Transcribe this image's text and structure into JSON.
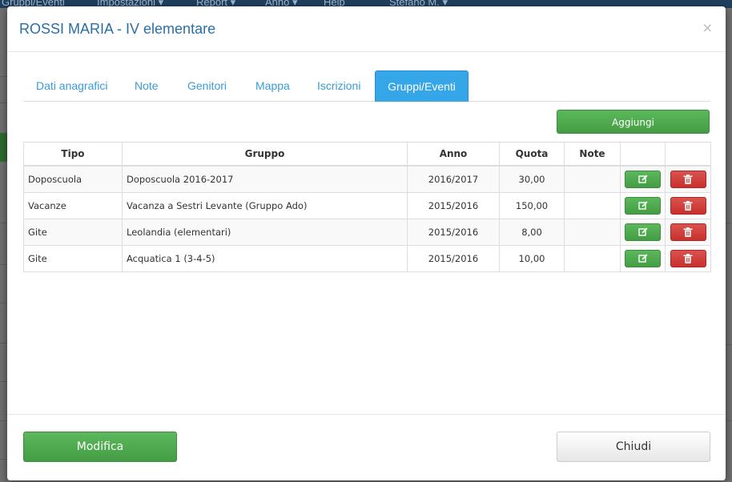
{
  "background_nav": {
    "items": [
      "Gruppi/Eventi",
      "Impostazioni ▾",
      "Report ▾",
      "Anno ▾",
      "Help",
      "Stefano M. ▾"
    ]
  },
  "modal": {
    "title": "ROSSI MARIA - IV elementare",
    "close_icon": "×",
    "tabs": [
      {
        "label": "Dati anagrafici",
        "active": false
      },
      {
        "label": "Note",
        "active": false
      },
      {
        "label": "Genitori",
        "active": false
      },
      {
        "label": "Mappa",
        "active": false
      },
      {
        "label": "Iscrizioni",
        "active": false
      },
      {
        "label": "Gruppi/Eventi",
        "active": true
      }
    ],
    "add_button": "Aggiungi",
    "table": {
      "headers": [
        "Tipo",
        "Gruppo",
        "Anno",
        "Quota",
        "Note",
        "",
        ""
      ],
      "rows": [
        {
          "tipo": "Doposcuola",
          "gruppo": "Doposcuola 2016-2017",
          "anno": "2016/2017",
          "quota": "30,00",
          "note": ""
        },
        {
          "tipo": "Vacanze",
          "gruppo": "Vacanza a Sestri Levante (Gruppo Ado)",
          "anno": "2015/2016",
          "quota": "150,00",
          "note": ""
        },
        {
          "tipo": "Gite",
          "gruppo": "Leolandia (elementari)",
          "anno": "2015/2016",
          "quota": "8,00",
          "note": ""
        },
        {
          "tipo": "Gite",
          "gruppo": "Acquatica 1 (3-4-5)",
          "anno": "2015/2016",
          "quota": "10,00",
          "note": ""
        }
      ],
      "row_actions": {
        "edit_icon": "edit-icon",
        "delete_icon": "trash-icon"
      }
    },
    "footer": {
      "modifica_button": "Modifica",
      "chiudi_button": "Chiudi"
    }
  },
  "colors": {
    "title": "#2b6ea6",
    "tab_link": "#3a9bd5",
    "tab_active_bg": "#35a6e8",
    "success": "#5cb85c",
    "danger": "#d9534f"
  }
}
